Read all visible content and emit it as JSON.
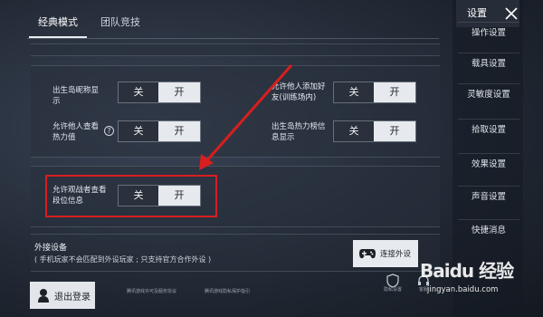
{
  "tabs": [
    {
      "label": "经典模式",
      "active": true
    },
    {
      "label": "团队竞技",
      "active": false
    }
  ],
  "settings": {
    "row1_left_label": "出生岛昵称显示",
    "row1_right_label": "允许他人添加好友(训练场内)",
    "row2_left_label": "允许他人查看热力值",
    "row2_right_label": "出生岛热力榜信息显示",
    "row3_label": "允许观战者查看段位信息",
    "off_label": "关",
    "on_label": "开",
    "row1_left_value": "on",
    "row1_right_value": "on",
    "row2_left_value": "on",
    "row2_right_value": "on",
    "row3_value": "on"
  },
  "help_glyph": "?",
  "external": {
    "title": "外接设备",
    "desc": "( 手机玩家不会匹配到外设玩家 ; 只支持官方合作外设 )",
    "button_label": "连接外设"
  },
  "logout_label": "退出登录",
  "policy_links": [
    "腾讯游戏许可及服务协议",
    "腾讯游戏隐私保护指引"
  ],
  "sidebar": {
    "title": "设置",
    "close_glyph": "X",
    "items": [
      "操作设置",
      "载具设置",
      "灵敏度设置",
      "拾取设置",
      "效果设置",
      "声音设置",
      "快捷消息"
    ]
  },
  "bottom_icons": [
    "隐私设置",
    "客服"
  ],
  "watermark": {
    "brand": "Baidu 经验",
    "url": "jingyan.baidu.com"
  },
  "colors": {
    "highlight": "#d81e1e",
    "arrow": "#d81e1e"
  }
}
